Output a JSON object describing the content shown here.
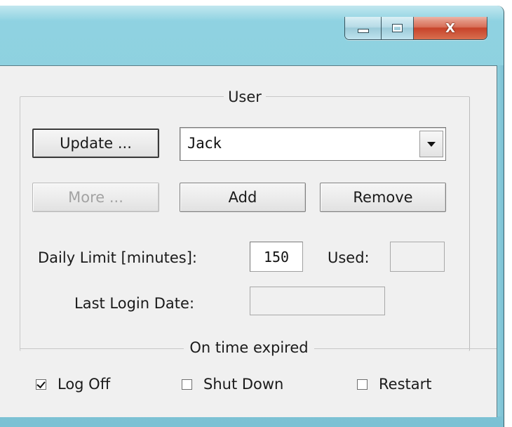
{
  "window": {
    "minimize_label": "",
    "maximize_label": "",
    "close_label": "X"
  },
  "user_group": {
    "title": "User",
    "update_button": "Update ...",
    "user_combo_value": "Jack",
    "more_button": "More ...",
    "add_button": "Add",
    "remove_button": "Remove",
    "daily_limit_label": "Daily Limit [minutes]:",
    "daily_limit_value": "150",
    "used_label": "Used:",
    "used_value": "",
    "last_login_label": "Last Login Date:",
    "last_login_value": ""
  },
  "on_expired_group": {
    "title": "On time expired",
    "options": [
      {
        "label": "Log Off",
        "checked": true
      },
      {
        "label": "Shut Down",
        "checked": false
      },
      {
        "label": "Restart",
        "checked": false
      }
    ]
  }
}
